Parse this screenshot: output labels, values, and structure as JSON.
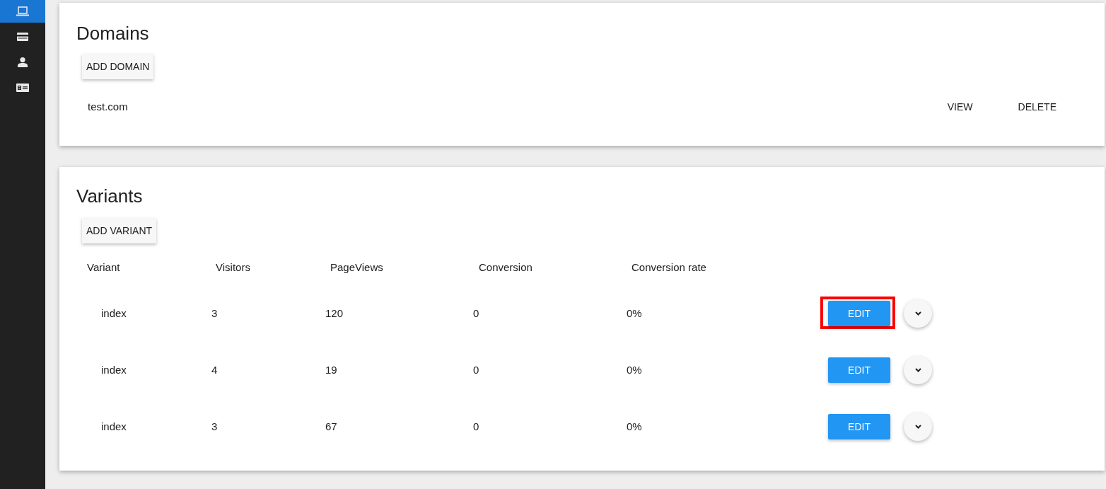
{
  "sidebar": {
    "items": [
      {
        "selected": true
      },
      {
        "selected": false
      },
      {
        "selected": false
      },
      {
        "selected": false
      }
    ]
  },
  "domains": {
    "title": "Domains",
    "add_button": "ADD DOMAIN",
    "rows": [
      {
        "name": "test.com",
        "actions": [
          "VIEW",
          "DELETE"
        ]
      }
    ]
  },
  "variants": {
    "title": "Variants",
    "add_button": "ADD VARIANT",
    "columns": [
      "Variant",
      "Visitors",
      "PageViews",
      "Conversion",
      "Conversion rate"
    ],
    "rows": [
      {
        "cells": [
          "index",
          "3",
          "120",
          "0",
          "0%"
        ],
        "edit_button": "EDIT",
        "highlighted": true
      },
      {
        "cells": [
          "index",
          "4",
          "19",
          "0",
          "0%"
        ],
        "edit_button": "EDIT",
        "highlighted": false
      },
      {
        "cells": [
          "index",
          "3",
          "67",
          "0",
          "0%"
        ],
        "edit_button": "EDIT",
        "highlighted": false
      }
    ]
  }
}
